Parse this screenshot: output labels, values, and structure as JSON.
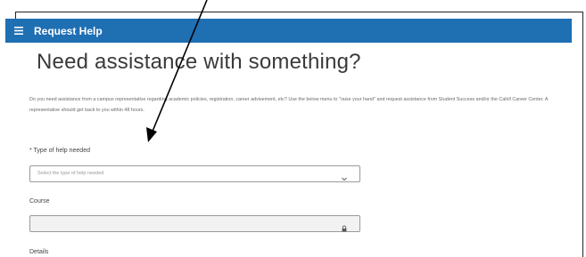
{
  "app_bar": {
    "title": "Request Help",
    "menu_icon": "hamburger-menu-icon"
  },
  "main": {
    "heading": "Need assistance with something?",
    "description": "Do you need assistance from a campus representative regarding academic policies, registration, career advisement, etc? Use the below menu to \"raise your hand\" and request assistance from Student Success and/or the Cahill Career Center. A representative should get back to you within 48 hours."
  },
  "form": {
    "help_type": {
      "label": "* Type of help needed",
      "placeholder": "Select the type of help needed",
      "icon": "chevron-down-icon"
    },
    "course": {
      "label": "Course",
      "icon": "lock-icon"
    },
    "details": {
      "label": "Details"
    }
  },
  "annotation": {
    "arrow_color": "#000000"
  },
  "colors": {
    "app_bar": "#1f6fb3"
  }
}
